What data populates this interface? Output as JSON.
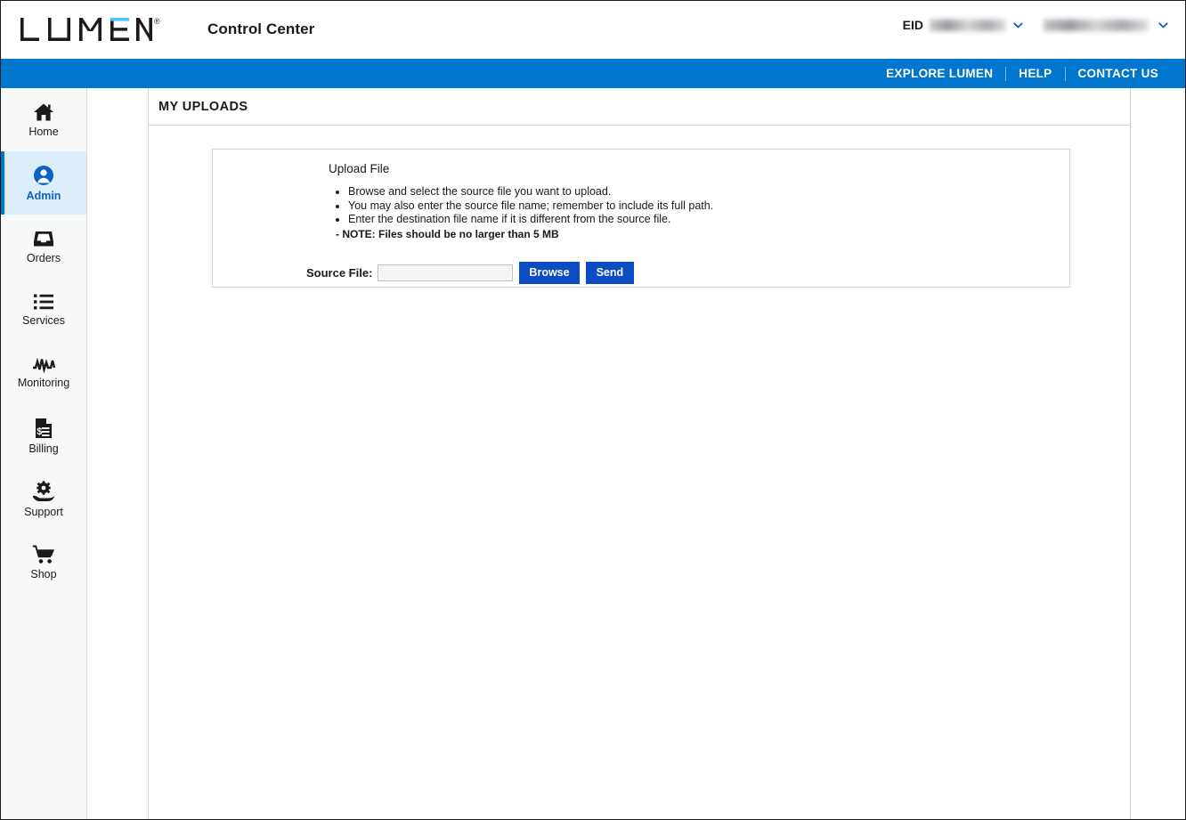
{
  "header": {
    "logo_text": "LUMEN",
    "logo_registered": "®",
    "app_title": "Control Center",
    "eid_label": "EID",
    "eid_value_redacted": true,
    "account_value_redacted": true,
    "chevron_icon": "chevron-down-icon",
    "accent_blue": "#0076CE"
  },
  "navbar": {
    "links": [
      {
        "label": "EXPLORE LUMEN"
      },
      {
        "label": "HELP"
      },
      {
        "label": "CONTACT US"
      }
    ],
    "background": "#0076CE"
  },
  "sidebar": {
    "items": [
      {
        "label": "Home",
        "icon": "home-icon",
        "active": false
      },
      {
        "label": "Admin",
        "icon": "user-circle-icon",
        "active": true
      },
      {
        "label": "Orders",
        "icon": "inbox-tray-icon",
        "active": false
      },
      {
        "label": "Services",
        "icon": "list-icon",
        "active": false
      },
      {
        "label": "Monitoring",
        "icon": "pulse-line-icon",
        "active": false
      },
      {
        "label": "Billing",
        "icon": "invoice-document-icon",
        "active": false
      },
      {
        "label": "Support",
        "icon": "gear-in-hand-icon",
        "active": false
      },
      {
        "label": "Shop",
        "icon": "shopping-cart-icon",
        "active": false
      }
    ],
    "active_background": "#DDEEFB",
    "active_accent": "#0076CE"
  },
  "main": {
    "page_title": "MY UPLOADS",
    "panel": {
      "title": "Upload File",
      "bullets": [
        "Browse and select the source file you want to upload.",
        "You may also enter the source file name; remember to include its full path.",
        "Enter the destination file name if it is different from the source file."
      ],
      "note": "- NOTE: Files should be no larger than 5 MB",
      "form": {
        "source_label": "Source File:",
        "source_value": "",
        "source_placeholder": "",
        "browse_label": "Browse",
        "send_label": "Send",
        "button_color": "#0B4BC4"
      }
    }
  }
}
